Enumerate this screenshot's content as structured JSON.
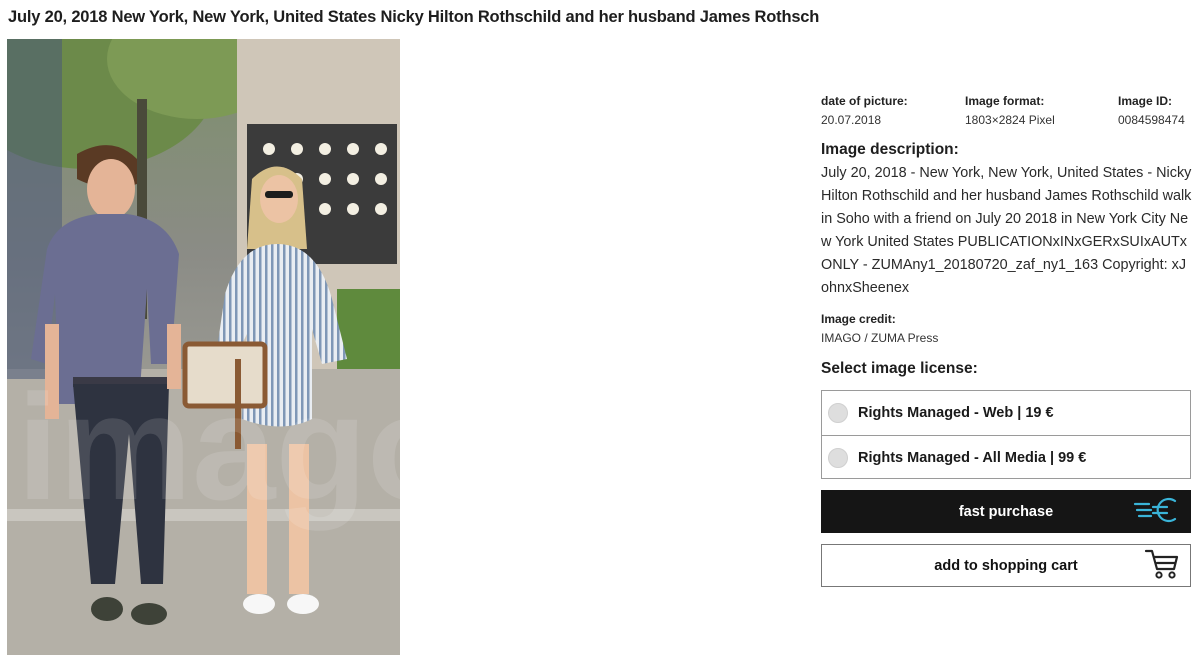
{
  "page": {
    "title": "July 20, 2018 New York, New York, United States Nicky Hilton Rothschild and her husband James Rothsch"
  },
  "meta": {
    "date_label": "date of picture:",
    "date_value": "20.07.2018",
    "format_label": "Image format:",
    "format_value": "1803×2824 Pixel",
    "id_label": "Image ID:",
    "id_value": "0084598474"
  },
  "description": {
    "heading": "Image description:",
    "text": "July 20, 2018 - New York, New York, United States - Nicky Hilton Rothschild and her husband James Rothschild walk in Soho with a friend on July 20 2018 in New York City New York United States PUBLICATIONxINxGERxSUIxAUTxONLY - ZUMAny1_20180720_zaf_ny1_163 Copyright: xJohnxSheenex"
  },
  "credit": {
    "label": "Image credit:",
    "value": "IMAGO / ZUMA Press"
  },
  "license": {
    "heading": "Select image license:",
    "options": [
      {
        "label": "Rights Managed - Web | 19 €",
        "selected": false
      },
      {
        "label": "Rights Managed - All Media | 99 €",
        "selected": false
      }
    ]
  },
  "actions": {
    "fast_purchase": "fast purchase",
    "add_to_cart": "add to shopping cart"
  },
  "photo": {
    "watermark": "imago"
  },
  "colors": {
    "dark_button": "#151515",
    "euro_icon": "#3ab4d8",
    "border": "#9a9a9a"
  },
  "icons": {
    "fast_purchase": "euro-speed-icon",
    "cart": "shopping-cart-icon",
    "radio": "radio-circle-icon"
  }
}
